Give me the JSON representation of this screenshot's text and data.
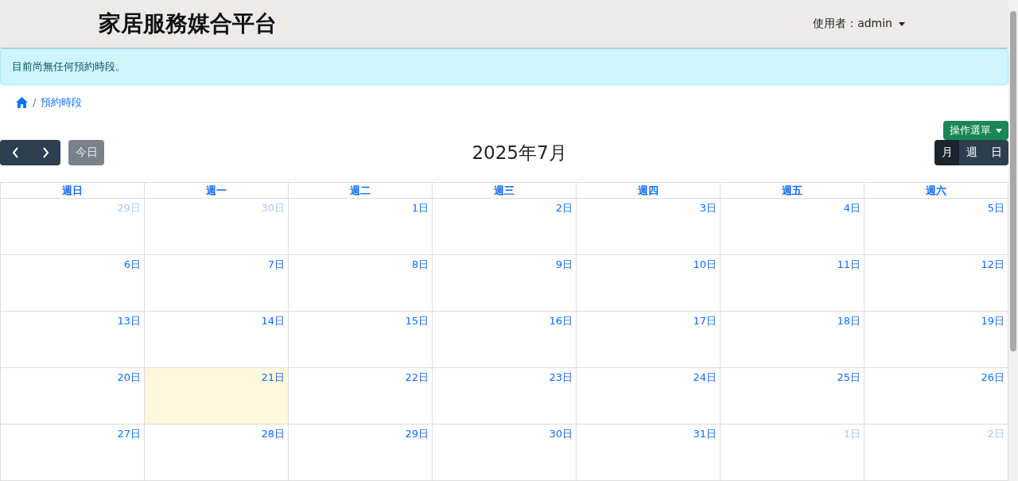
{
  "header": {
    "title": "家居服務媒合平台",
    "user_menu": "使用者：admin"
  },
  "alert": {
    "message": "目前尚無任何預約時段。"
  },
  "breadcrumb": {
    "separator": "/",
    "items": [
      "預約時段"
    ]
  },
  "action_menu": {
    "label": "操作選單"
  },
  "calendar": {
    "title": "2025年7月",
    "today_button": {
      "label": "今日",
      "disabled": true
    },
    "views": [
      {
        "label": "月",
        "selected": true
      },
      {
        "label": "週",
        "selected": false
      },
      {
        "label": "日",
        "selected": false
      }
    ],
    "weekdays": [
      "週日",
      "週一",
      "週二",
      "週三",
      "週四",
      "週五",
      "週六"
    ],
    "weeks": [
      [
        {
          "label": "29日",
          "other_month": true,
          "today": false
        },
        {
          "label": "30日",
          "other_month": true,
          "today": false
        },
        {
          "label": "1日",
          "other_month": false,
          "today": false
        },
        {
          "label": "2日",
          "other_month": false,
          "today": false
        },
        {
          "label": "3日",
          "other_month": false,
          "today": false
        },
        {
          "label": "4日",
          "other_month": false,
          "today": false
        },
        {
          "label": "5日",
          "other_month": false,
          "today": false
        }
      ],
      [
        {
          "label": "6日",
          "other_month": false,
          "today": false
        },
        {
          "label": "7日",
          "other_month": false,
          "today": false
        },
        {
          "label": "8日",
          "other_month": false,
          "today": false
        },
        {
          "label": "9日",
          "other_month": false,
          "today": false
        },
        {
          "label": "10日",
          "other_month": false,
          "today": false
        },
        {
          "label": "11日",
          "other_month": false,
          "today": false
        },
        {
          "label": "12日",
          "other_month": false,
          "today": false
        }
      ],
      [
        {
          "label": "13日",
          "other_month": false,
          "today": false
        },
        {
          "label": "14日",
          "other_month": false,
          "today": false
        },
        {
          "label": "15日",
          "other_month": false,
          "today": false
        },
        {
          "label": "16日",
          "other_month": false,
          "today": false
        },
        {
          "label": "17日",
          "other_month": false,
          "today": false
        },
        {
          "label": "18日",
          "other_month": false,
          "today": false
        },
        {
          "label": "19日",
          "other_month": false,
          "today": false
        }
      ],
      [
        {
          "label": "20日",
          "other_month": false,
          "today": false
        },
        {
          "label": "21日",
          "other_month": false,
          "today": true
        },
        {
          "label": "22日",
          "other_month": false,
          "today": false
        },
        {
          "label": "23日",
          "other_month": false,
          "today": false
        },
        {
          "label": "24日",
          "other_month": false,
          "today": false
        },
        {
          "label": "25日",
          "other_month": false,
          "today": false
        },
        {
          "label": "26日",
          "other_month": false,
          "today": false
        }
      ],
      [
        {
          "label": "27日",
          "other_month": false,
          "today": false
        },
        {
          "label": "28日",
          "other_month": false,
          "today": false
        },
        {
          "label": "29日",
          "other_month": false,
          "today": false
        },
        {
          "label": "30日",
          "other_month": false,
          "today": false
        },
        {
          "label": "31日",
          "other_month": false,
          "today": false
        },
        {
          "label": "1日",
          "other_month": true,
          "today": false
        },
        {
          "label": "2日",
          "other_month": true,
          "today": false
        }
      ]
    ]
  }
}
